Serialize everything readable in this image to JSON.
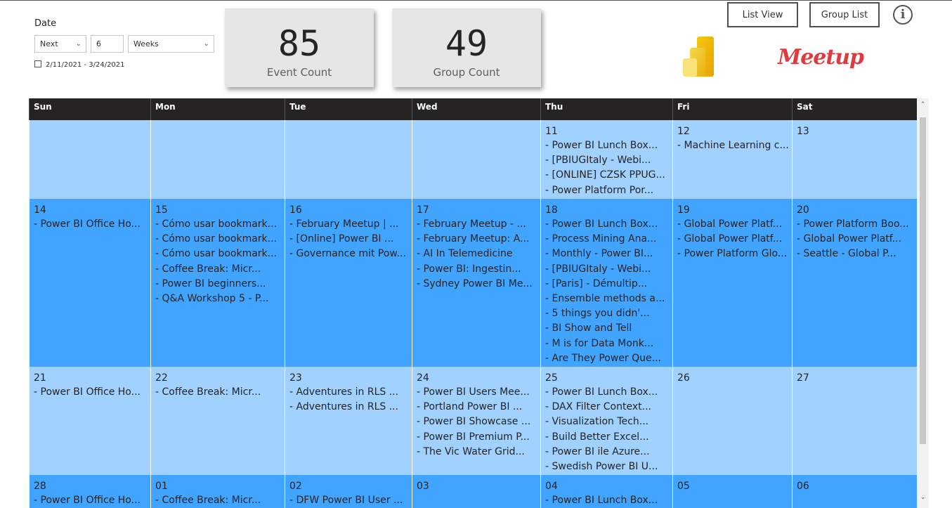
{
  "filter": {
    "title": "Date",
    "relative": "Next",
    "count": "6",
    "unit": "Weeks",
    "range": "2/11/2021 - 3/24/2021"
  },
  "cards": [
    {
      "value": "85",
      "label": "Event Count"
    },
    {
      "value": "49",
      "label": "Group Count"
    }
  ],
  "buttons": {
    "list_view": "List View",
    "group_list": "Group List",
    "info": "i"
  },
  "logos": {
    "meetup": "Meetup"
  },
  "colors": {
    "header": "#252423",
    "light_row": "#a0d1ff",
    "dark_row": "#41a4ff"
  },
  "calendar": {
    "days": [
      "Sun",
      "Mon",
      "Tue",
      "Wed",
      "Thu",
      "Fri",
      "Sat"
    ],
    "weeks": [
      [
        {
          "date": "",
          "events": []
        },
        {
          "date": "",
          "events": []
        },
        {
          "date": "",
          "events": []
        },
        {
          "date": "",
          "events": []
        },
        {
          "date": "11",
          "events": [
            "- Power BI Lunch Box...",
            "- [PBIUGItaly - Webi...",
            "- [ONLINE] CZSK PPUG...",
            "- Power Platform Por..."
          ]
        },
        {
          "date": "12",
          "events": [
            "- Machine Learning c..."
          ]
        },
        {
          "date": "13",
          "events": []
        }
      ],
      [
        {
          "date": "14",
          "events": [
            "- Power BI Office Ho..."
          ]
        },
        {
          "date": "15",
          "events": [
            "- Cómo usar bookmark...",
            "- Cómo usar bookmark...",
            "- Cómo usar bookmark...",
            "- Coffee Break: Micr...",
            "- Power BI beginners...",
            "- Q&A Workshop 5 - P..."
          ]
        },
        {
          "date": "16",
          "events": [
            "- February Meetup | ...",
            "- [Online] Power BI ...",
            "- Governance mit Pow..."
          ]
        },
        {
          "date": "17",
          "events": [
            "- February Meetup - ...",
            "- February Meetup: A...",
            "- AI In Telemedicine",
            "- Power BI: Ingestin...",
            "- Sydney Power BI Me..."
          ]
        },
        {
          "date": "18",
          "events": [
            "- Power BI Lunch Box...",
            "- Process Mining Ana...",
            "- Monthly - Power BI...",
            "- [PBIUGItaly - Webi...",
            "- [Paris] - Démultip...",
            "- Ensemble methods a...",
            "- 5 things you didn'...",
            "- BI Show and Tell",
            "- M is for Data Monk...",
            "- Are They Power Que..."
          ]
        },
        {
          "date": "19",
          "events": [
            "- Global Power Platf...",
            "- Global Power Platf...",
            "- Power Platform Glo..."
          ]
        },
        {
          "date": "20",
          "events": [
            "- Power Platform Boo...",
            "- Global Power Platf...",
            "- Seattle - Global P..."
          ]
        }
      ],
      [
        {
          "date": "21",
          "events": [
            "- Power BI Office Ho..."
          ]
        },
        {
          "date": "22",
          "events": [
            "- Coffee Break: Micr..."
          ]
        },
        {
          "date": "23",
          "events": [
            "- Adventures in RLS ...",
            "- Adventures in RLS ..."
          ]
        },
        {
          "date": "24",
          "events": [
            "- Power BI Users Mee...",
            "- Portland Power BI ...",
            "- Power BI Showcase ...",
            "- Power BI Premium P...",
            "- The Vic Water Grid..."
          ]
        },
        {
          "date": "25",
          "events": [
            "- Power BI Lunch Box...",
            "- DAX Filter Context...",
            "- Visualization Tech...",
            "- Build Better Excel...",
            "- Power BI ile Azure...",
            "- Swedish Power BI U..."
          ]
        },
        {
          "date": "26",
          "events": []
        },
        {
          "date": "27",
          "events": []
        }
      ],
      [
        {
          "date": "28",
          "events": [
            "- Power BI Office Ho..."
          ]
        },
        {
          "date": "01",
          "events": [
            "- Coffee Break: Micr..."
          ]
        },
        {
          "date": "02",
          "events": [
            "- DFW Power BI User ..."
          ]
        },
        {
          "date": "03",
          "events": []
        },
        {
          "date": "04",
          "events": [
            "- Power BI Lunch Box..."
          ]
        },
        {
          "date": "05",
          "events": []
        },
        {
          "date": "06",
          "events": []
        }
      ]
    ]
  }
}
